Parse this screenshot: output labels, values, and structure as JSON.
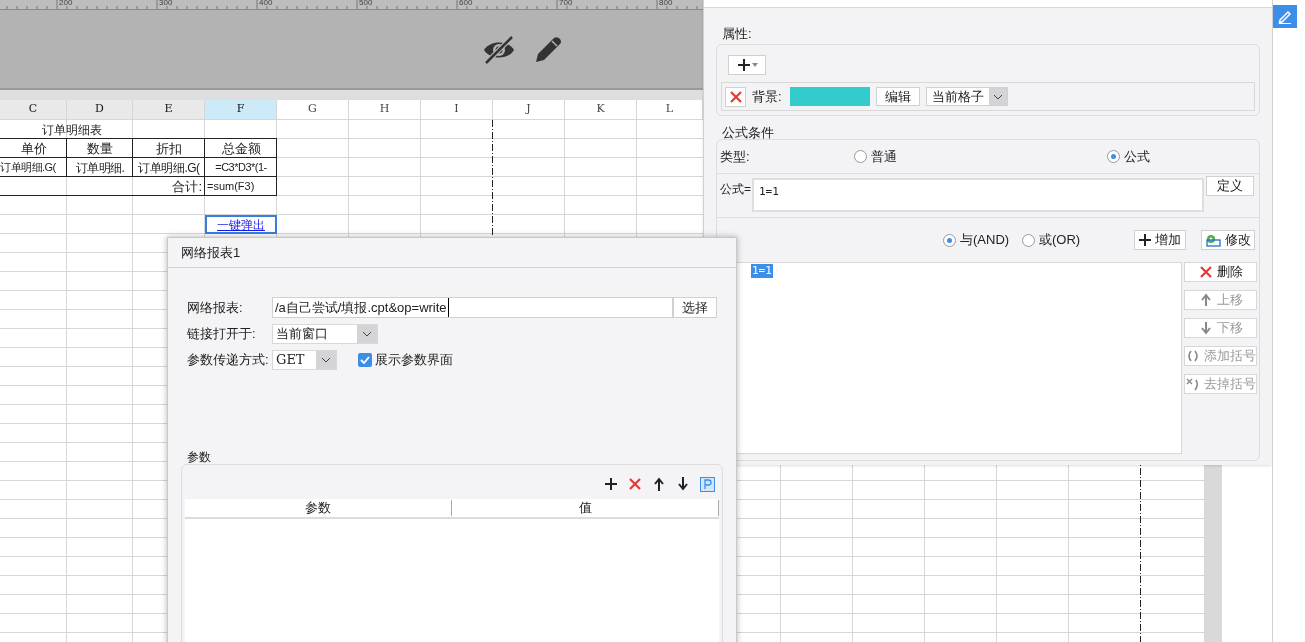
{
  "ruler": {
    "labels": [
      "200",
      "300",
      "400",
      "500",
      "600",
      "700",
      "800"
    ]
  },
  "columns": [
    {
      "label": "C",
      "selected": false,
      "highlighted": true
    },
    {
      "label": "D",
      "selected": false,
      "highlighted": true
    },
    {
      "label": "E",
      "selected": false,
      "highlighted": true
    },
    {
      "label": "F",
      "selected": true,
      "highlighted": true
    },
    {
      "label": "G",
      "selected": false,
      "highlighted": false
    },
    {
      "label": "H",
      "selected": false,
      "highlighted": false
    },
    {
      "label": "I",
      "selected": false,
      "highlighted": false
    },
    {
      "label": "J",
      "selected": false,
      "highlighted": false
    },
    {
      "label": "K",
      "selected": false,
      "highlighted": false
    },
    {
      "label": "L",
      "selected": false,
      "highlighted": false
    }
  ],
  "report_table": {
    "title": "订单明细表",
    "headers": [
      "单价",
      "数量",
      "折扣",
      "总金额"
    ],
    "detail_row": [
      "订单明细.G(",
      "订单明细.",
      "订单明细.G(",
      "=C3*D3*(1-"
    ],
    "total_label": "合计:",
    "total_formula": "=sum(F3)"
  },
  "link_cell": {
    "text": "一键弹出",
    "selected": true
  },
  "style_panel": {
    "attributes_label": "属性:",
    "background_label": "背景:",
    "swatch": {
      "color": "#33cccc"
    },
    "edit_button": "编辑",
    "scope": "当前格子",
    "condition_label": "公式条件",
    "type_label": "类型:",
    "type_options": [
      {
        "label": "普通",
        "selected": false
      },
      {
        "label": "公式",
        "selected": true
      }
    ],
    "formula_label": "公式=",
    "formula": "1=1",
    "define_button": "定义",
    "logic_options": [
      {
        "label": "与(AND)",
        "selected": true
      },
      {
        "label": "或(OR)",
        "selected": false
      }
    ],
    "add_button": "增加",
    "modify_button": "修改",
    "conditions": [
      {
        "text": "1=1",
        "selected": true
      }
    ],
    "side_buttons": [
      {
        "label": "删除",
        "kind": "delete",
        "disabled": false
      },
      {
        "label": "上移",
        "kind": "up",
        "disabled": true
      },
      {
        "label": "下移",
        "kind": "down",
        "disabled": true
      },
      {
        "label": "添加括号",
        "kind": "add_paren",
        "disabled": true
      },
      {
        "label": "去掉括号",
        "kind": "remove_paren",
        "disabled": true
      }
    ]
  },
  "dialog": {
    "title": "网络报表1",
    "report_label": "网络报表:",
    "report_path": "/a自己尝试/填报.cpt&op=write",
    "choose_button": "选择",
    "open_in_label": "链接打开于:",
    "open_in": "当前窗口",
    "method_label": "参数传递方式:",
    "method": "GET",
    "show_params": {
      "label": "展示参数界面",
      "checked": true
    },
    "params_group": "参数",
    "params_columns": [
      "参数",
      "值"
    ]
  }
}
